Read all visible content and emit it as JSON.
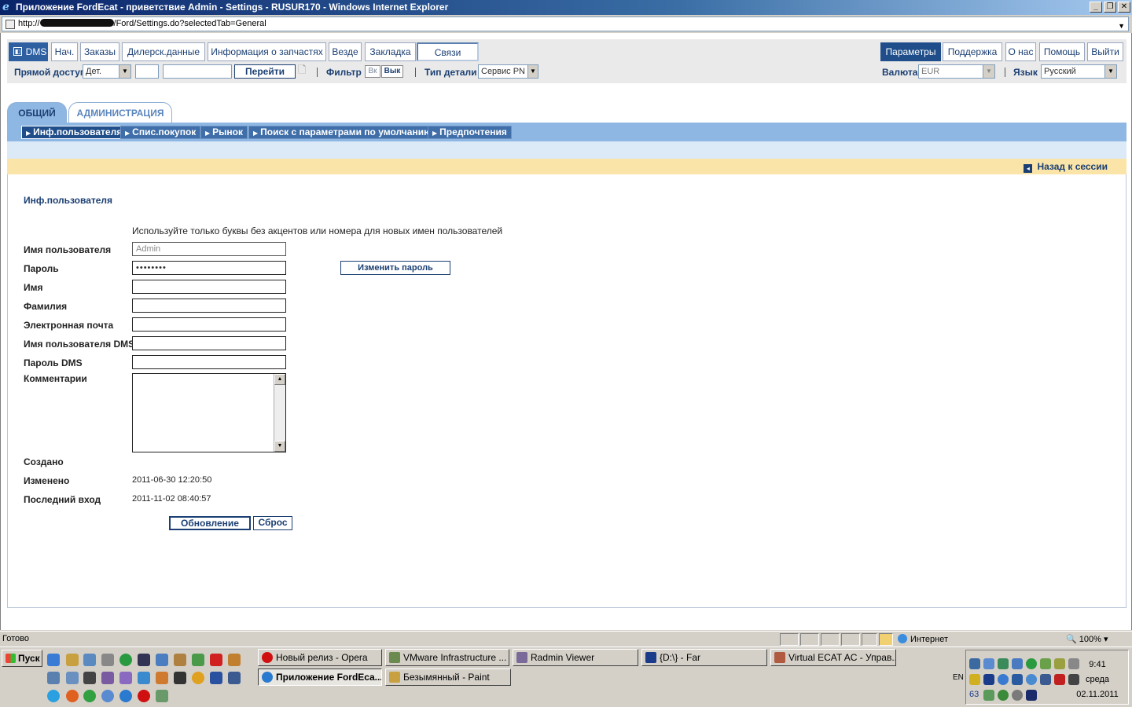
{
  "window": {
    "title": "Приложение FordEcat - приветствие Admin - Settings - RUSUR170 - Windows Internet Explorer",
    "url_prefix": "http://",
    "url_suffix": "/Ford/Settings.do?selectedTab=General"
  },
  "topnav": {
    "left_tabs": [
      "DMS",
      "Нач.",
      "Заказы",
      "Дилерск.данные",
      "Информация о запчастях",
      "Везде",
      "Закладка",
      "Связи"
    ],
    "right_tabs": [
      "Параметры",
      "Поддержка",
      "О нас",
      "Помощь",
      "Выйти"
    ],
    "direct_access_label": "Прямой доступ",
    "direct_access_select": "Дет.",
    "go_button": "Перейти",
    "filter_label": "Фильтр",
    "filter_on": "Вк",
    "filter_off": "Вык",
    "part_type_label": "Тип детали",
    "part_type_select": "Сервис PN",
    "currency_label": "Валюта",
    "currency_select": "EUR",
    "language_label": "Язык",
    "language_select": "Русский"
  },
  "tabs": {
    "general": "ОБЩИЙ",
    "admin": "АДМИНИСТРАЦИЯ"
  },
  "subnav": [
    "Инф.пользователя",
    "Спис.покупок",
    "Рынок",
    "Поиск с параметрами по умолчанию",
    "Предпочтения"
  ],
  "back_link": "Назад к сессии",
  "form": {
    "section_title": "Инф.пользователя",
    "hint": "Используйте только буквы без акцентов или номера для новых имен пользователей",
    "username_label": "Имя пользователя",
    "username_value": "Admin",
    "password_label": "Пароль",
    "password_value": "••••••••",
    "change_password_button": "Изменить пароль",
    "first_name_label": "Имя",
    "last_name_label": "Фамилия",
    "email_label": "Электронная почта",
    "dms_user_label": "Имя пользователя DMS",
    "dms_password_label": "Пароль DMS",
    "comments_label": "Комментарии",
    "created_label": "Создано",
    "modified_label": "Изменено",
    "modified_value": "2011-06-30 12:20:50",
    "last_login_label": "Последний вход",
    "last_login_value": "2011-11-02 08:40:57",
    "update_button": "Обновление",
    "reset_button": "Сброс"
  },
  "statusbar": {
    "status": "Готово",
    "zone": "Интернет",
    "zoom": "100%"
  },
  "taskbar": {
    "start": "Пуск",
    "tasks_row1": [
      "Новый релиз - Opera",
      "VMware Infrastructure ...",
      "Radmin Viewer",
      "{D:\\} - Far",
      "Virtual ECAT AC - Управ..."
    ],
    "tasks_row2": [
      "Приложение FordEca...",
      "Безымянный - Paint"
    ],
    "lang": "EN",
    "tray_number": "63",
    "clock_time": "9:41",
    "clock_day": "среда",
    "clock_date": "02.11.2011"
  }
}
